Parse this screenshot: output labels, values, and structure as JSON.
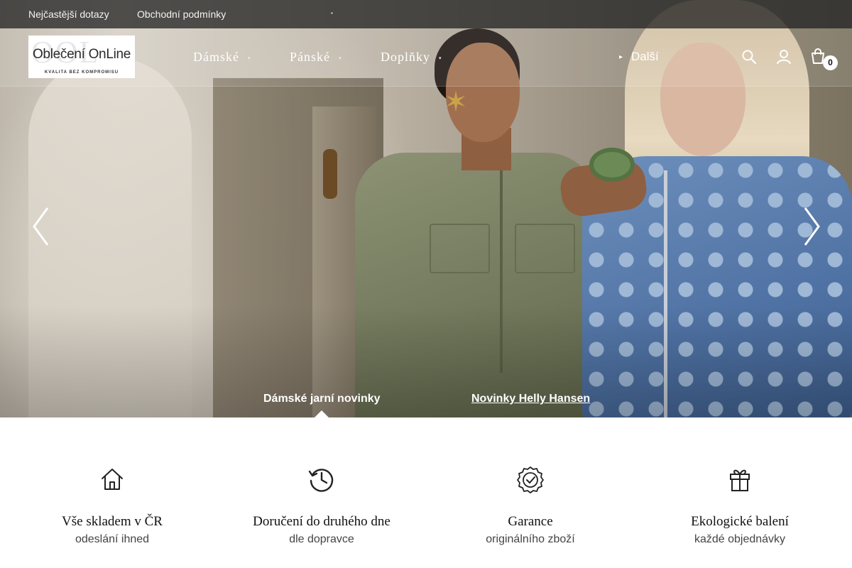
{
  "topbar": {
    "links": [
      "Nejčastější dotazy",
      "Obchodní podmínky"
    ]
  },
  "logo": {
    "background_text": "OOL",
    "name": "Oblečení OnLine",
    "tagline": "KVALITA BEZ KOMPROMISU"
  },
  "nav": {
    "items": [
      "Dámské",
      "Pánské",
      "Doplňky"
    ],
    "more_label": "Další"
  },
  "header": {
    "icons": [
      "search-icon",
      "user-icon",
      "cart-icon"
    ],
    "cart_count": "0"
  },
  "hero": {
    "slides": [
      {
        "label": "Dámské jarní novinky",
        "active": true
      },
      {
        "label": "Novinky Helly Hansen",
        "active": false
      }
    ]
  },
  "features": [
    {
      "icon": "home-icon",
      "title": "Vše skladem v ČR",
      "subtitle": "odeslání ihned"
    },
    {
      "icon": "clock-history-icon",
      "title": "Doručení do druhého dne",
      "subtitle": "dle dopravce"
    },
    {
      "icon": "badge-check-icon",
      "title": "Garance",
      "subtitle": "originálního zboží"
    },
    {
      "icon": "gift-icon",
      "title": "Ekologické balení",
      "subtitle": "každé objednávky"
    }
  ],
  "colors": {
    "topbar_bg": "#282828",
    "text_dark": "#111111",
    "text_muted": "#444444",
    "badge_bg": "#ffffff"
  }
}
